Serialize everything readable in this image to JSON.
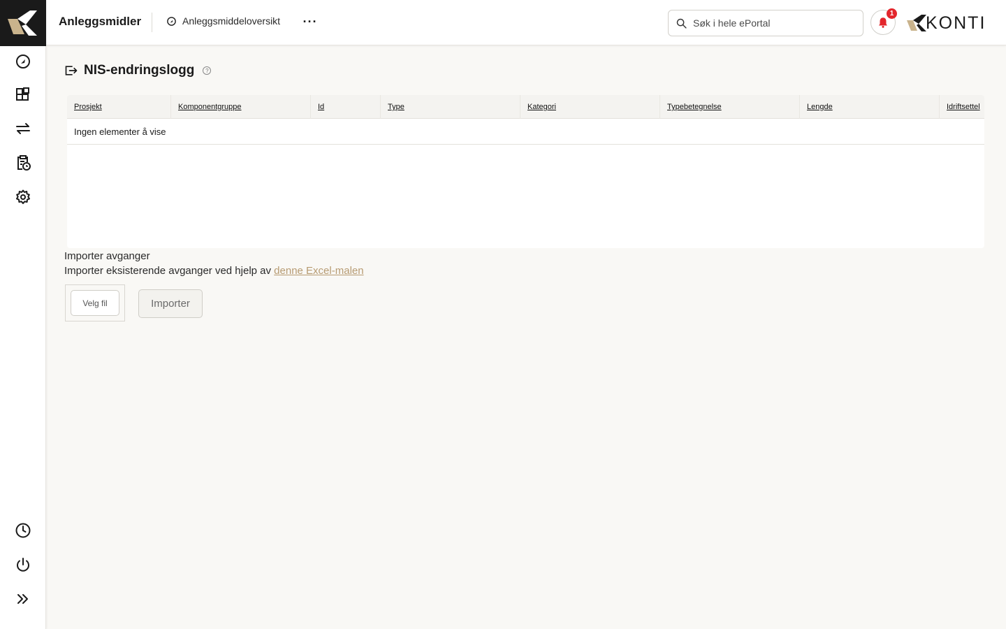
{
  "header": {
    "app_title": "Anleggsmidler",
    "breadcrumb": "Anleggsmiddeloversikt",
    "more_label": "···",
    "search_placeholder": "Søk i hele ePortal",
    "notification_count": "1",
    "brand_name": "KONTI"
  },
  "sidebar": {
    "top_items": [
      {
        "icon": "dashboard-icon"
      },
      {
        "icon": "components-icon"
      },
      {
        "icon": "transfer-icon"
      },
      {
        "icon": "clipboard-clock-icon"
      },
      {
        "icon": "settings-icon"
      }
    ],
    "bottom_items": [
      {
        "icon": "history-icon"
      },
      {
        "icon": "power-icon"
      },
      {
        "icon": "expand-icon"
      }
    ]
  },
  "page": {
    "title": "NIS-endringslogg",
    "help_label": "?"
  },
  "table": {
    "columns": [
      "Prosjekt",
      "Komponentgruppe",
      "Id",
      "Type",
      "Kategori",
      "Typebetegnelse",
      "Lengde",
      "Idriftsettel"
    ],
    "empty_text": "Ingen elementer å vise"
  },
  "import": {
    "title": "Importer avganger",
    "description": "Importer eksisterende avganger ved hjelp av ",
    "link_text": "denne Excel-malen",
    "choose_file_label": "Velg fil",
    "import_button_label": "Importer"
  },
  "colors": {
    "accent_gold": "#b79b72",
    "badge_red": "#e3262c",
    "rail_dark": "#1a1a1a"
  }
}
